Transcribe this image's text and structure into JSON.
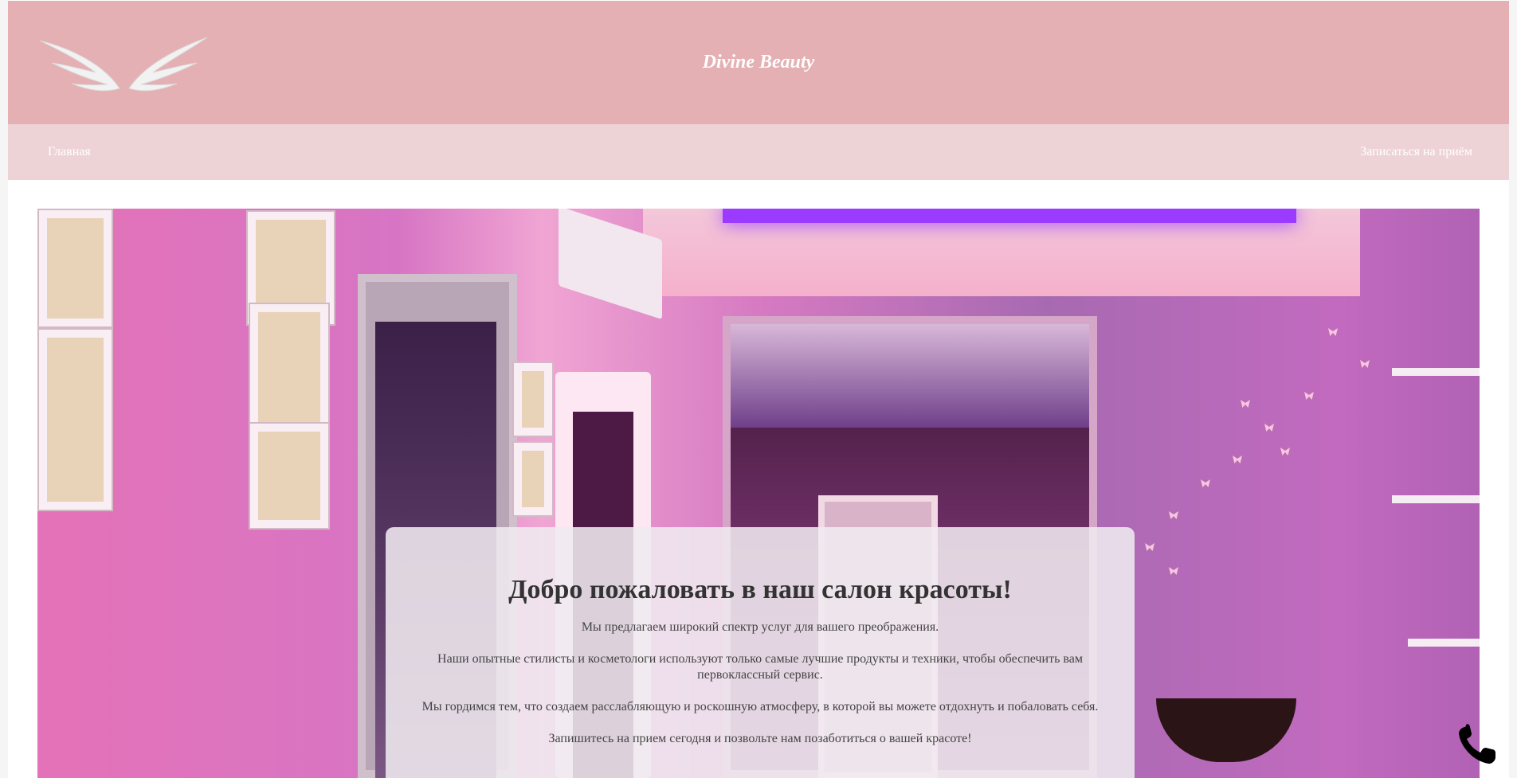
{
  "header": {
    "site_title": "Divine Beauty",
    "logo_icon": "angel-wings-icon",
    "background_color": "#e5b0b3"
  },
  "nav": {
    "home_label": "Главная",
    "booking_label": "Записаться на приём",
    "background_color": "#eed3d6"
  },
  "welcome": {
    "title": "Добро пожаловать в наш салон красоты!",
    "paragraphs": [
      "Мы предлагаем широкий спектр услуг для вашего преображения.",
      "Наши опытные стилисты и косметологи используют только самые лучшие продукты и техники, чтобы обеспечить вам первоклассный сервис.",
      "Мы гордимся тем, что создаем расслабляющую и роскошную атмосферу, в которой вы можете отдохнуть и побаловать себя.",
      "Запишитесь на прием сегодня и позвольте нам позаботиться о вашей красоте!"
    ]
  },
  "hero": {
    "image_subject": "beauty-salon-interior"
  },
  "floating": {
    "phone_icon": "phone-icon"
  }
}
